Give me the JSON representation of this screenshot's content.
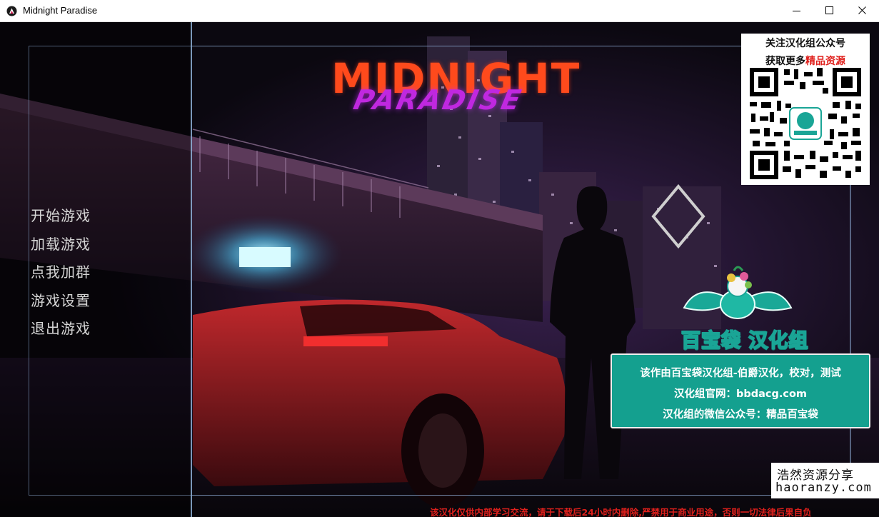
{
  "window": {
    "title": "Midnight Paradise"
  },
  "logo": {
    "line1": "MIDNIGHT",
    "line2": "PARADISE"
  },
  "menu": {
    "items": [
      "开始游戏",
      "加载游戏",
      "点我加群",
      "游戏设置",
      "退出游戏"
    ]
  },
  "qr_promo": {
    "line1": "关注汉化组公众号",
    "line2_prefix": "获取更多",
    "line2_highlight": "精品资源"
  },
  "group": {
    "name": "百宝袋 汉化组"
  },
  "credits": {
    "line1": "该作由百宝袋汉化组-伯爵汉化，校对，测试",
    "line2": "汉化组官网：bbdacg.com",
    "line3": "汉化组的微信公众号：精品百宝袋"
  },
  "watermark": {
    "cn": "浩然资源分享",
    "en": "haoranzy.com"
  },
  "disclaimer": "该汉化仅供内部学习交流，请于下载后24小时内删除,严禁用于商业用途，否则一切法律后果自负",
  "colors": {
    "accent_teal": "#14a08f",
    "logo_orange": "#ff4a1c",
    "logo_purple": "#c028e0",
    "disclaimer_red": "#e0201c",
    "frame_blue": "#8fb1d8"
  }
}
